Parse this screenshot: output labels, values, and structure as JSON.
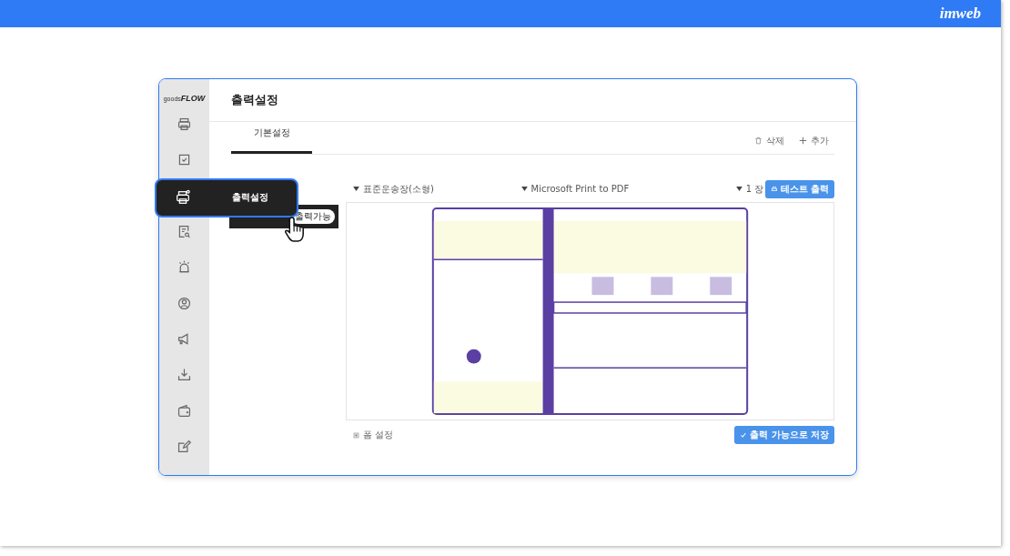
{
  "brand": {
    "logo": "imweb"
  },
  "app": {
    "logo": {
      "prefix": "goods",
      "name": "FLOW"
    },
    "title": "출력설정",
    "nav": [
      {
        "hovered": false
      },
      {
        "hovered": false
      },
      {
        "hovered": true,
        "tooltip": "출력설정"
      },
      {
        "hovered": false
      },
      {
        "hovered": false
      },
      {
        "hovered": false
      },
      {
        "hovered": false
      },
      {
        "hovered": false
      },
      {
        "hovered": false
      },
      {
        "hovered": false
      }
    ],
    "tabs": [
      {
        "label": "기본설정",
        "selected": true
      }
    ],
    "actions": [
      {
        "kind": "delete",
        "label": "삭제"
      },
      {
        "kind": "add",
        "label": "추가"
      }
    ],
    "list_row": {
      "badge": "출력가능"
    },
    "toolbar": {
      "form": "표준운송장(소형)",
      "printer": "Microsoft Print to PDF",
      "copies": "1 장",
      "test_button": "테스트 출력"
    },
    "form_settings": "폼 설정",
    "save_button": "출력 가능으로 저장"
  }
}
